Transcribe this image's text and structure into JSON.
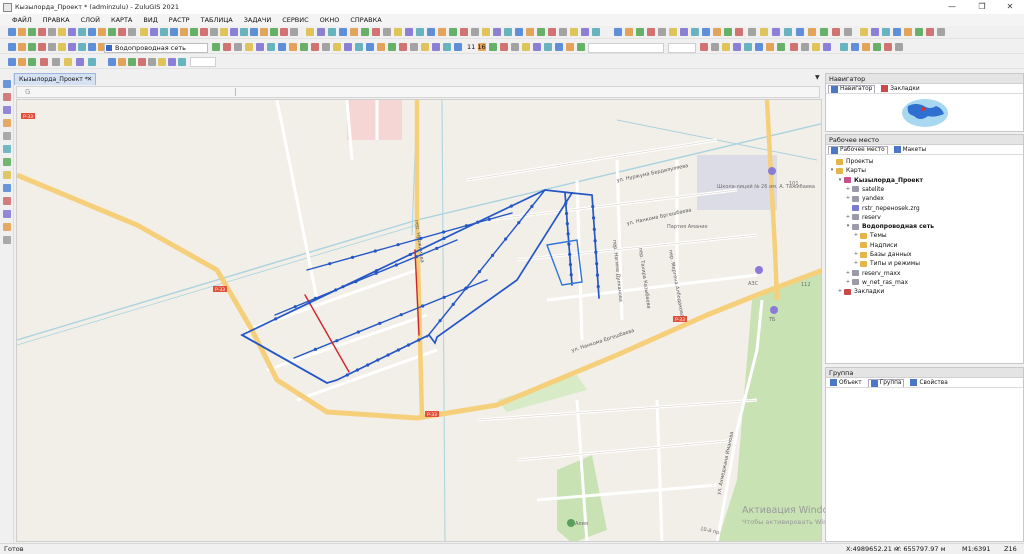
{
  "window": {
    "title": "Кызылорда_Проект * (adminzulu) - ZuluGIS 2021",
    "controls": [
      "—",
      "❐",
      "✕"
    ]
  },
  "menu": [
    "ФАЙЛ",
    "ПРАВКА",
    "СЛОЙ",
    "КАРТА",
    "ВИД",
    "РАСТР",
    "ТАБЛИЦА",
    "ЗАДАЧИ",
    "СЕРВИС",
    "ОКНО",
    "СПРАВКА"
  ],
  "toolbar": {
    "layer_combo": "Водопроводная сеть",
    "scale_text": "11 16"
  },
  "document": {
    "tab_label": "Кызылорда_Проект *",
    "close": "✕",
    "address_glyph": "G"
  },
  "map": {
    "road_labels": [
      "Р-33",
      "Р-33",
      "Р-33",
      "Р-33"
    ],
    "street_labels": [
      "ул. Нуржума Бердилуляева",
      "пер. Нуржимава",
      "ул. Нанкома Бргешбаева",
      "ул. Нанкома Ергешбаева",
      "пер. Тахира Казыбаева",
      "пер. Мергена Албодакова",
      "пер. Нагима Дулканова",
      "ул. Ахмеджана Иманова"
    ],
    "poi_labels": [
      "Школа-лицей № 26 им. А. Тажибаева",
      "Партия Амание",
      "АЗС",
      "ТБ",
      "Алия"
    ],
    "house_numbers": [
      "101",
      "112"
    ],
    "extra_labels": [
      "10-й пр."
    ]
  },
  "navigator": {
    "title": "Навигатор",
    "tabs": [
      "Навигатор",
      "Закладки"
    ]
  },
  "workspace": {
    "title": "Рабочее место",
    "tabs": [
      "Рабочее место",
      "Макеты"
    ],
    "tree": [
      {
        "label": "Проекты",
        "level": 1,
        "toggle": "",
        "bold": false,
        "icon": "folder-icon"
      },
      {
        "label": "Карты",
        "level": 1,
        "toggle": "▾",
        "bold": false,
        "icon": "folder-icon"
      },
      {
        "label": "Кызылорда_Проект",
        "level": 2,
        "toggle": "▾",
        "bold": true,
        "icon": "map-icon"
      },
      {
        "label": "satelite",
        "level": 3,
        "toggle": "+",
        "bold": false,
        "icon": "layer-icon"
      },
      {
        "label": "yandex",
        "level": 3,
        "toggle": "+",
        "bold": false,
        "icon": "layer-icon"
      },
      {
        "label": "rstr_переноsek.zrg",
        "level": 3,
        "toggle": "",
        "bold": false,
        "icon": "raster-icon"
      },
      {
        "label": "reserv",
        "level": 3,
        "toggle": "+",
        "bold": false,
        "icon": "layer-icon"
      },
      {
        "label": "Водопроводная сеть",
        "level": 3,
        "toggle": "▾",
        "bold": true,
        "icon": "layer-icon"
      },
      {
        "label": "Темы",
        "level": 4,
        "toggle": "+",
        "bold": false,
        "icon": "folder-icon"
      },
      {
        "label": "Надписи",
        "level": 4,
        "toggle": "",
        "bold": false,
        "icon": "label-icon"
      },
      {
        "label": "Базы данных",
        "level": 4,
        "toggle": "+",
        "bold": false,
        "icon": "folder-icon"
      },
      {
        "label": "Типы и режимы",
        "level": 4,
        "toggle": "+",
        "bold": false,
        "icon": "folder-icon"
      },
      {
        "label": "reserv_maxx",
        "level": 3,
        "toggle": "+",
        "bold": false,
        "icon": "layer-icon"
      },
      {
        "label": "w_net_ras_max",
        "level": 3,
        "toggle": "+",
        "bold": false,
        "icon": "layer-icon"
      },
      {
        "label": "Закладки",
        "level": 2,
        "toggle": "+",
        "bold": false,
        "icon": "bookmark-icon"
      }
    ]
  },
  "group": {
    "title": "Группа",
    "tabs": [
      "Объект",
      "Группа",
      "Свойства"
    ]
  },
  "status": {
    "left": "Готов",
    "x": "X:4989652.21 м",
    "y": "Y: 655797.97 м",
    "scale": "M1:6391",
    "zoom": "Z16"
  },
  "watermark": {
    "line1": "Активация Windows",
    "line2": "Чтобы активировать Windows, перейдите в раздел \"Параметры\"."
  },
  "colors": {
    "pipe": "#2457c5",
    "pipe_red": "#d0232b",
    "road": "#f6cf7a",
    "park": "#c8e2b4"
  }
}
